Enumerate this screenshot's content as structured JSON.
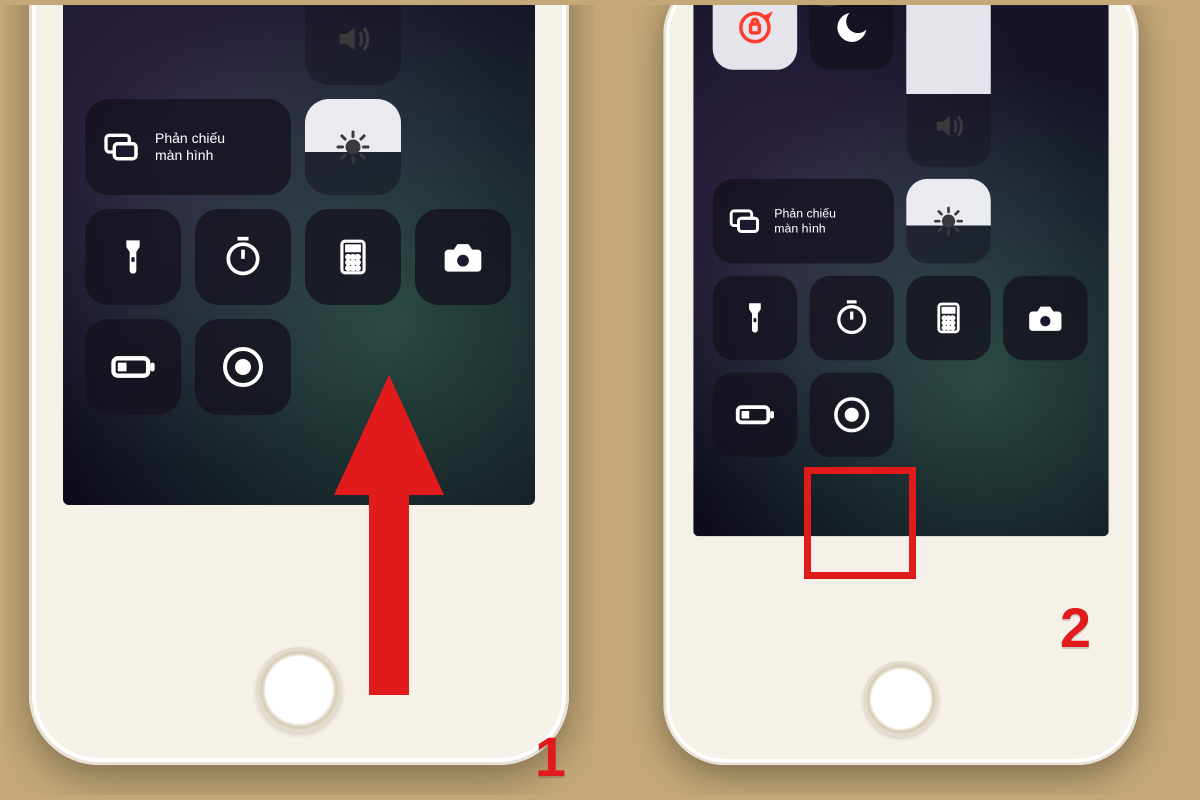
{
  "steps": {
    "one": "1",
    "two": "2"
  },
  "mirror": {
    "line1": "Phản chiếu",
    "line2": "màn hình"
  },
  "icons": {
    "wifi": "wifi-icon",
    "bluetooth": "bluetooth-icon",
    "prev": "previous-track-icon",
    "play": "play-icon",
    "next": "next-track-icon",
    "orientation_lock": "orientation-lock-icon",
    "dnd": "do-not-disturb-moon-icon",
    "screen_mirror": "screen-mirroring-icon",
    "brightness": "brightness-sun-icon",
    "volume": "volume-icon",
    "flashlight": "flashlight-icon",
    "timer": "timer-icon",
    "calculator": "calculator-icon",
    "camera": "camera-icon",
    "low_power": "low-power-battery-icon",
    "screen_record": "screen-record-icon"
  },
  "colors": {
    "annotation_red": "#e11b1b",
    "wifi_blue": "#1f74ff",
    "orientation_lock_red": "#ff3b30"
  }
}
